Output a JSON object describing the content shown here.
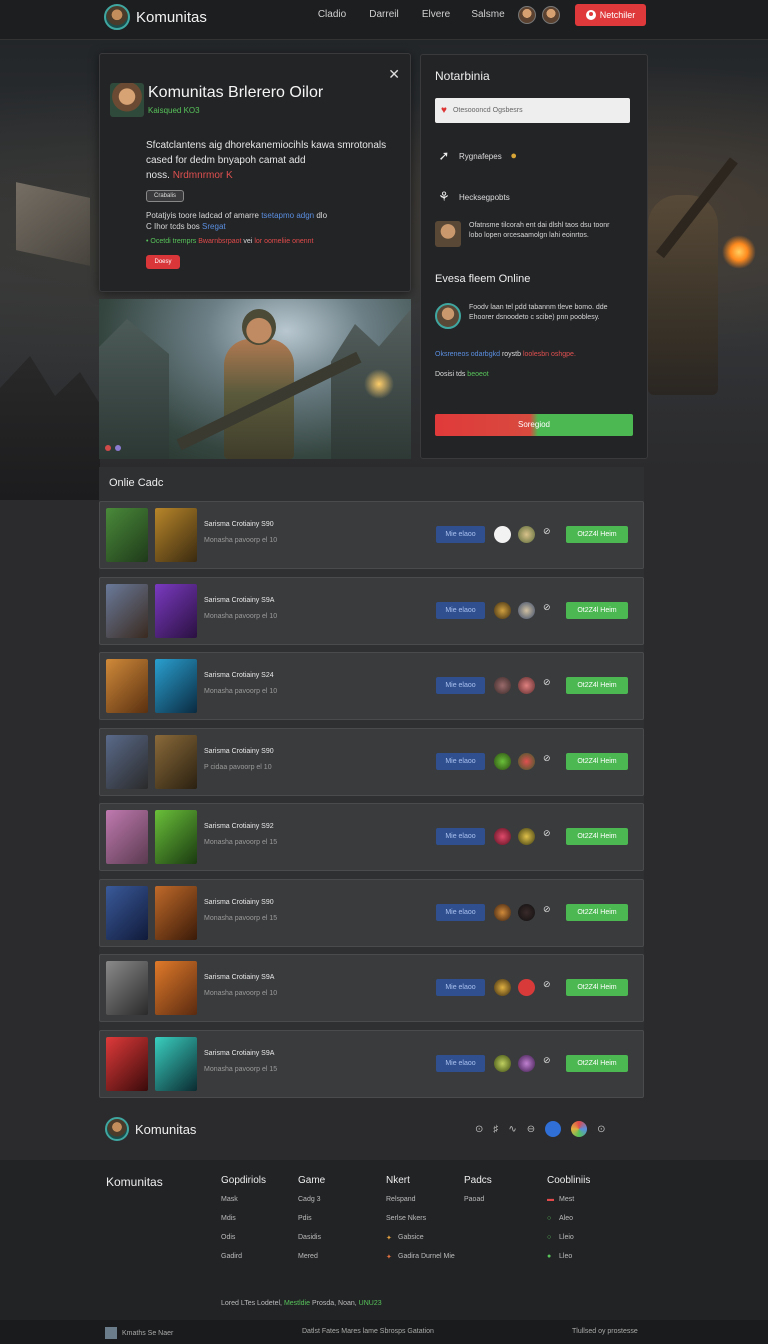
{
  "nav": {
    "brand": "Komunitas",
    "links": [
      "Cladio",
      "Darreil",
      "Elvere",
      "Salsme"
    ],
    "notify_label": "Netchiler"
  },
  "modal": {
    "title": "Komunitas Brlerero Oilor",
    "subtitle": "Kaisqued KO3",
    "desc_main": "Sfcatclantens aig dhorekanemiocihls kawa smrotonals cased for dedm bnyapoh camat add",
    "desc_highlight": "Nrdmnrmor K",
    "desc_prefix": "noss.",
    "small_button": "Crabalis",
    "line1_text": "Potatjyis toore ladcad of amarre",
    "line1_blue": "tsetapmo adgn",
    "line1_end": "dlo",
    "line1_text2": "C Ihor tcds bos",
    "line1_blue2": "Sregat",
    "line2_a": "Ocetdi tremprs",
    "line2_b": "Bwarnbsrpaot",
    "line2_c": "vei",
    "line2_d": "lor",
    "line2_e": "oomeliie onennt",
    "red_button": "Doesy"
  },
  "right_panel": {
    "title": "Notarbinia",
    "input_placeholder": "Otesoooncd Ogsbesrs",
    "row1_label": "Rygnafepes",
    "row2_label": "Hecksegpobts",
    "item1_text": "Ofatnsme tilcorah ent dai dlshl taos dsu toonr lobo lopen orcesaamolgn lahi eoinrtos.",
    "section_title": "Evesa fleem Online",
    "item2_text": "Foodv laan tel pdd tabannm tleve bomo. dde Ehoorer dsnoodeto c scibe) pnn pooblesy.",
    "tag_blue": "Oksreneos odarbgkd",
    "tag_mid": "roystb",
    "tag_red": "loolesbn oshgpe.",
    "status_text": "Dosisi tds",
    "status_green": "beoeot",
    "button": "Soregiod"
  },
  "online": {
    "title": "Onlie Cadc",
    "cards": [
      {
        "name": "Sarisma Crotiainy S90",
        "meta": "Monasha pavoorp el 10",
        "tag": "Mie elaoo",
        "button": "Ot2Z4l Heim"
      },
      {
        "name": "Sarisma Crotiainy S9A",
        "meta": "Monasha pavoorp el 10",
        "tag": "Mie elaoo",
        "button": "Ot2Z4l Heim"
      },
      {
        "name": "Sarisma Crotiainy S24",
        "meta": "Monasha pavoorp el 10",
        "tag": "Mie elaoo",
        "button": "Ot2Z4l Heim"
      },
      {
        "name": "Sarisma Crotiainy S90",
        "meta": "P cidaa pavoorp el 10",
        "tag": "Mie elaoo",
        "button": "Ot2Z4l Heim"
      },
      {
        "name": "Sarisma Crotiainy S92",
        "meta": "Monasha pavoorp el 15",
        "tag": "Mie elaoo",
        "button": "Ot2Z4l Heim"
      },
      {
        "name": "Sarisma Crotiainy S90",
        "meta": "Monasha pavoorp el 15",
        "tag": "Mie elaoo",
        "button": "Ot2Z4l Heim"
      },
      {
        "name": "Sarisma Crotiainy S9A",
        "meta": "Monasha pavoorp el 10",
        "tag": "Mie elaoo",
        "button": "Ot2Z4l Heim"
      },
      {
        "name": "Sarisma Crotiainy S9A",
        "meta": "Monasha pavoorp el 15",
        "tag": "Mie elaoo",
        "button": "Ot2Z4l Heim"
      }
    ]
  },
  "footer": {
    "brand": "Komunitas",
    "col_brand": "Komunitas",
    "col1": {
      "heading": "Gopdiriols",
      "items": [
        "Mask",
        "Mdis",
        "Odis",
        "Gadird"
      ]
    },
    "col2": {
      "heading": "Game",
      "items": [
        "Cadg 3",
        "Pdis",
        "Dasidis",
        "Mered"
      ]
    },
    "col3": {
      "heading": "Nkert",
      "items": [
        "Relspand",
        "Serlse Nkers",
        "Gabsice",
        "Gadira Durnel Mie"
      ]
    },
    "col4": {
      "heading": "Padcs",
      "items": [
        "Paoad"
      ]
    },
    "col5": {
      "heading": "Coobliniis",
      "items": [
        "Mest",
        "Aleo",
        "Lleio",
        "Lleo"
      ]
    },
    "copy_text": "Lored LTes Lodetel,",
    "copy_green1": "Mestldie",
    "copy_mid": "Prosda, Noan,",
    "copy_green2": "UNU23",
    "bottom_left": "Kmaths Se Naer",
    "bottom_mid": "Datlst Fates Mares lame Sbrosps Gatation",
    "bottom_right": "Tlullsed oy prostesse"
  }
}
